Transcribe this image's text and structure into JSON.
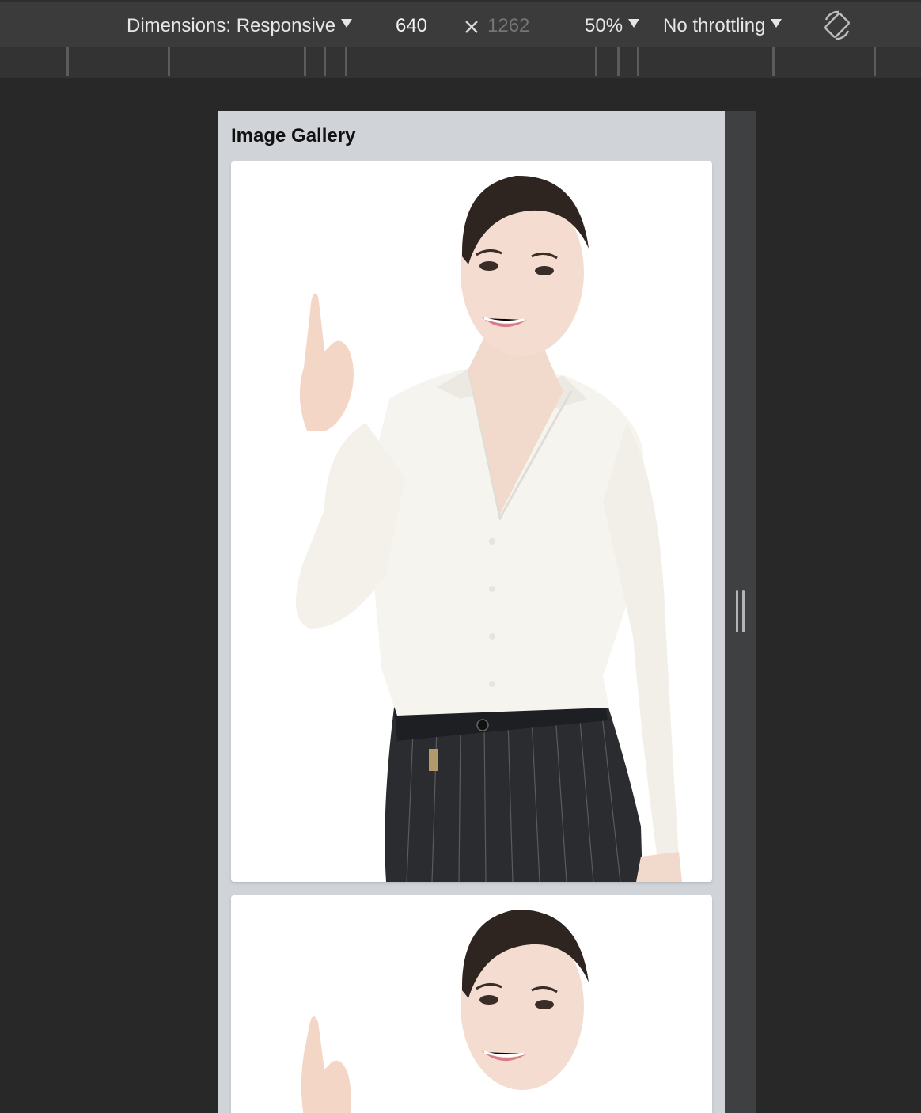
{
  "devtools": {
    "dimensions_label": "Dimensions: Responsive",
    "width_value": "640",
    "height_placeholder": "1262",
    "zoom_label": "50%",
    "throttling_label": "No throttling",
    "icons": {
      "dropdown": "caret-down-icon",
      "times": "times-icon",
      "rotate": "rotate-icon",
      "resize": "resize-handle-icon"
    }
  },
  "page": {
    "title": "Image Gallery",
    "gallery": [
      {
        "image": "woman-pointing-up-photo"
      },
      {
        "image": "woman-pointing-up-photo"
      }
    ]
  },
  "colors": {
    "toolbar_bg": "#3b3b3b",
    "page_bg": "#d0d3d8",
    "card_bg": "#ffffff",
    "devtools_bg": "#282828"
  }
}
